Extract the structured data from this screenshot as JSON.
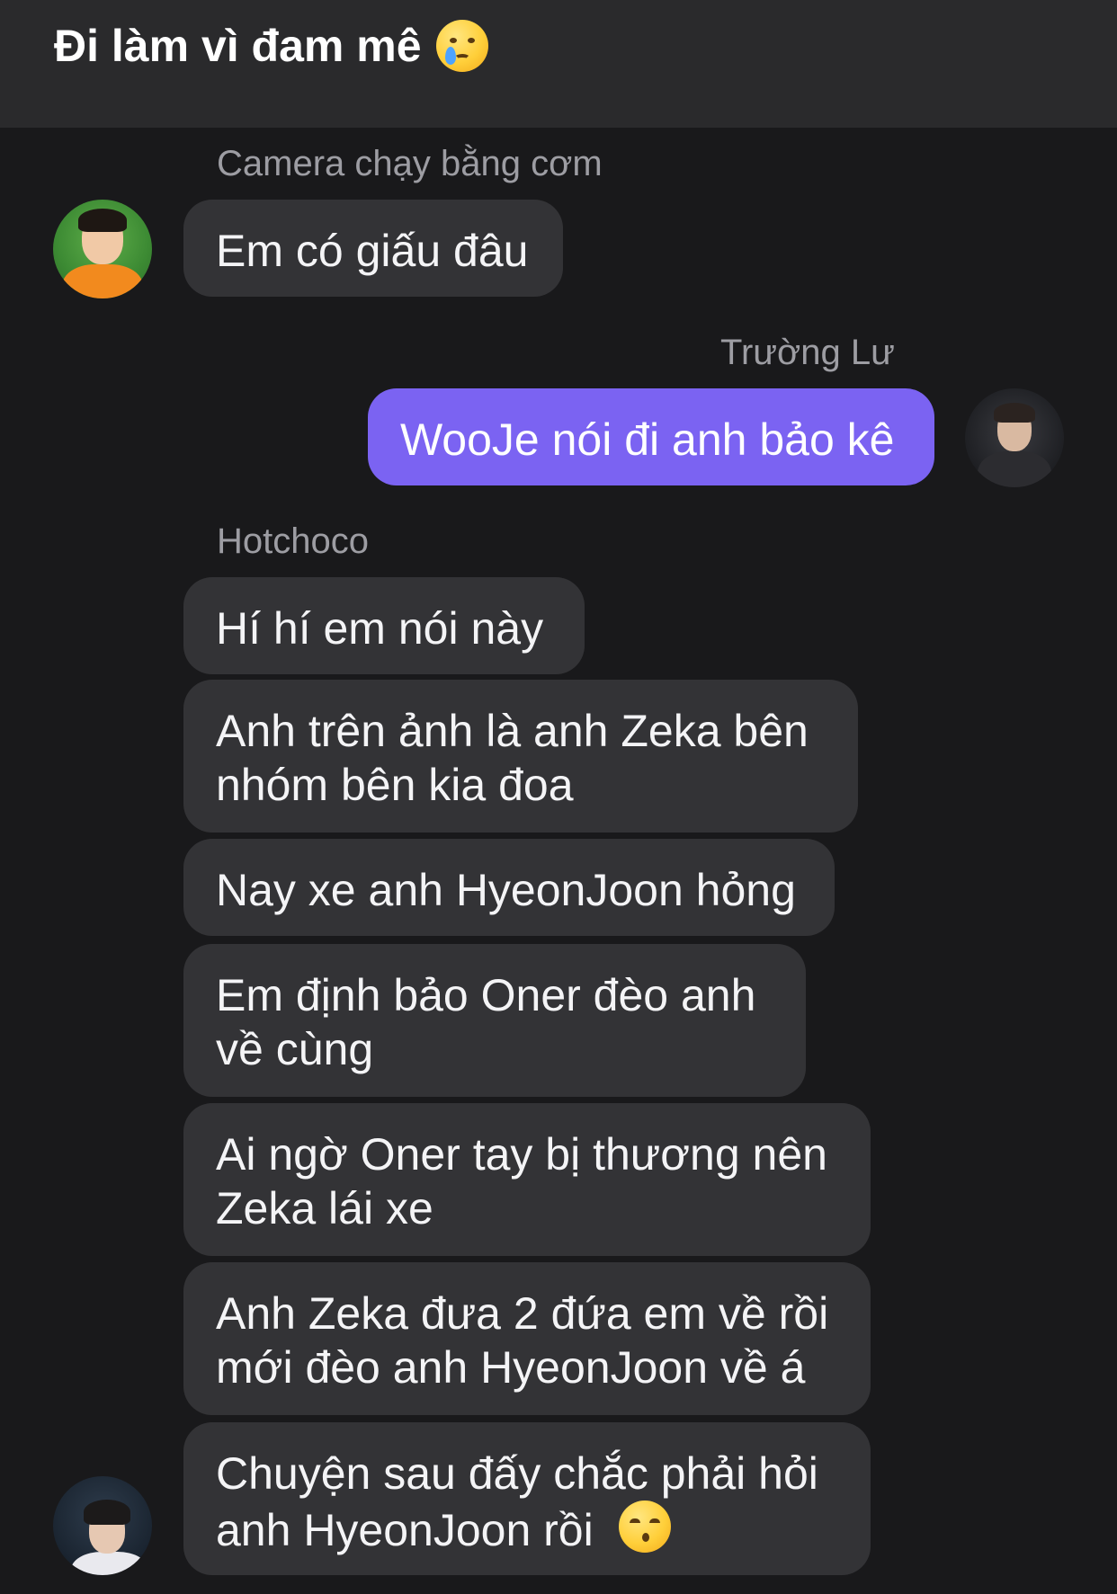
{
  "header": {
    "title": "Đi làm vì đam mê",
    "title_emoji": "crying-face"
  },
  "messages": [
    {
      "sender": "Camera chạy bằng cơm",
      "text": "Em có giấu đâu"
    },
    {
      "sender": "Trường Lư",
      "text": "WooJe nói đi anh bảo kê"
    },
    {
      "sender": "Hotchoco",
      "text": "Hí hí em nói này"
    },
    {
      "line1": "Anh trên ảnh là anh Zeka bên",
      "line2": "nhóm bên kia đoa"
    },
    {
      "text": "Nay xe anh HyeonJoon hỏng"
    },
    {
      "line1": "Em định bảo Oner đèo anh",
      "line2": "về cùng"
    },
    {
      "line1": "Ai ngờ Oner tay bị thương nên",
      "line2": "Zeka lái xe"
    },
    {
      "line1": "Anh Zeka đưa 2 đứa em về rồi",
      "line2": "mới đèo anh HyeonJoon về á"
    },
    {
      "line1": "Chuyện sau đấy chắc phải hỏi",
      "line2": "anh HyeonJoon rồi",
      "emoji": "kissing-face"
    }
  ],
  "colors": {
    "background": "#19191b",
    "header": "#2a2a2c",
    "bubble": "#333336",
    "my_bubble": "#7b63f2"
  }
}
